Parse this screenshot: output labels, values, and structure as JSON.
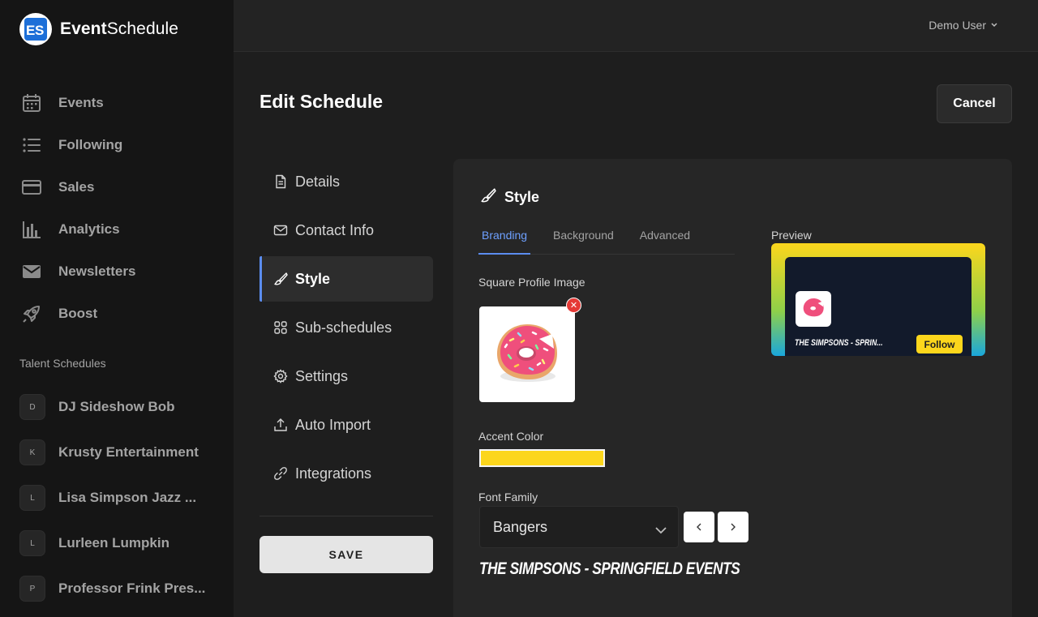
{
  "brand": {
    "name_bold": "Event",
    "name_rest": "Schedule",
    "logo_text": "ES"
  },
  "user": {
    "name": "Demo User"
  },
  "sidebar": {
    "items": [
      {
        "label": "Events",
        "icon": "calendar-icon"
      },
      {
        "label": "Following",
        "icon": "list-icon"
      },
      {
        "label": "Sales",
        "icon": "credit-card-icon"
      },
      {
        "label": "Analytics",
        "icon": "bar-chart-icon"
      },
      {
        "label": "Newsletters",
        "icon": "envelope-icon"
      },
      {
        "label": "Boost",
        "icon": "rocket-icon"
      }
    ],
    "talent_title": "Talent Schedules",
    "talent": [
      {
        "initial": "D",
        "name": "DJ Sideshow Bob"
      },
      {
        "initial": "K",
        "name": "Krusty Entertainment"
      },
      {
        "initial": "L",
        "name": "Lisa Simpson Jazz ..."
      },
      {
        "initial": "L",
        "name": "Lurleen Lumpkin"
      },
      {
        "initial": "P",
        "name": "Professor Frink Pres..."
      }
    ]
  },
  "page": {
    "title": "Edit Schedule",
    "cancel_label": "Cancel",
    "save_label": "SAVE"
  },
  "subnav": [
    {
      "label": "Details",
      "icon": "document-icon"
    },
    {
      "label": "Contact Info",
      "icon": "envelope-icon"
    },
    {
      "label": "Style",
      "icon": "brush-icon",
      "active": true
    },
    {
      "label": "Sub-schedules",
      "icon": "grid-icon"
    },
    {
      "label": "Settings",
      "icon": "gear-icon"
    },
    {
      "label": "Auto Import",
      "icon": "upload-icon"
    },
    {
      "label": "Integrations",
      "icon": "link-icon"
    }
  ],
  "style_card": {
    "title": "Style",
    "tabs": [
      "Branding",
      "Background",
      "Advanced"
    ],
    "active_tab": "Branding",
    "profile_label": "Square Profile Image",
    "accent_label": "Accent Color",
    "accent_color": "#fcd61c",
    "font_label": "Font Family",
    "font_value": "Bangers",
    "font_preview": "THE SIMPSONS - SPRINGFIELD EVENTS",
    "preview_label": "Preview",
    "preview_name": "THE SIMPSONS - SPRIN...",
    "follow_label": "Follow"
  }
}
